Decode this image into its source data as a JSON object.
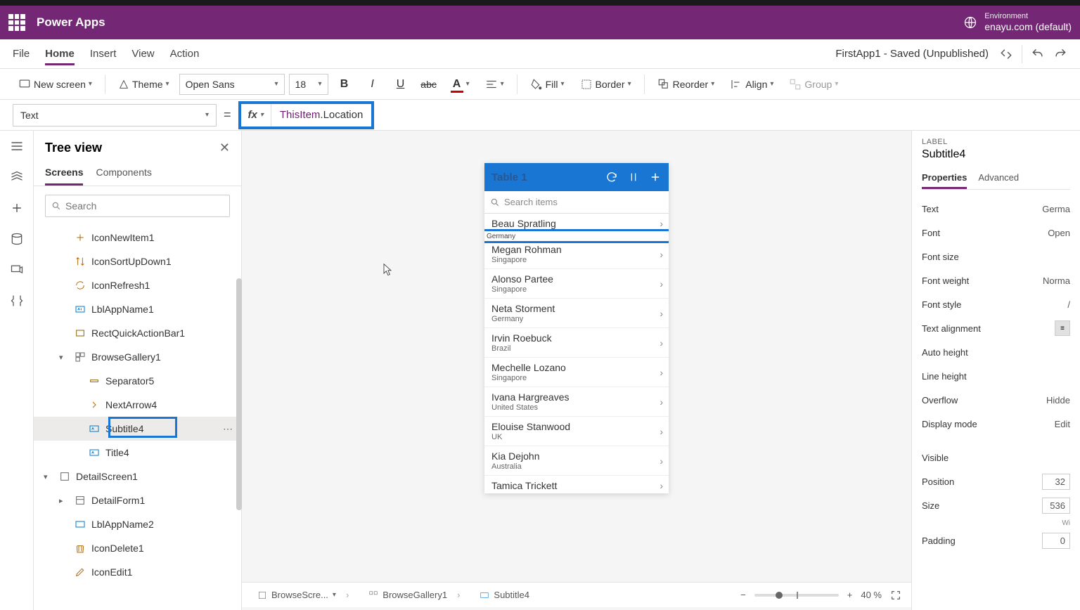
{
  "app": {
    "name": "Power Apps"
  },
  "env": {
    "label": "Environment",
    "value": "enayu.com (default)"
  },
  "menu": {
    "file": "File",
    "home": "Home",
    "insert": "Insert",
    "view": "View",
    "action": "Action",
    "doc": "FirstApp1 - Saved (Unpublished)"
  },
  "toolbar": {
    "newscreen": "New screen",
    "theme": "Theme",
    "font": "Open Sans",
    "size": "18",
    "fill": "Fill",
    "border": "Border",
    "reorder": "Reorder",
    "align": "Align",
    "group": "Group"
  },
  "formula": {
    "prop": "Text",
    "prefix": "ThisItem",
    "field": ".Location"
  },
  "tree": {
    "title": "Tree view",
    "tabs": {
      "screens": "Screens",
      "components": "Components"
    },
    "search": "Search",
    "items": {
      "iconNew": "IconNewItem1",
      "iconSort": "IconSortUpDown1",
      "iconRefresh": "IconRefresh1",
      "lblApp": "LblAppName1",
      "rect": "RectQuickActionBar1",
      "gallery": "BrowseGallery1",
      "sep": "Separator5",
      "arrow": "NextArrow4",
      "subtitle": "Subtitle4",
      "title": "Title4",
      "detail": "DetailScreen1",
      "form": "DetailForm1",
      "lblApp2": "LblAppName2",
      "iconDel": "IconDelete1",
      "iconEdit": "IconEdit1"
    }
  },
  "phone": {
    "header": "Table 1",
    "searchPlaceholder": "Search items",
    "selectedSub": "Germany",
    "rows": [
      {
        "name": "Beau Spratling",
        "sub": "Germany"
      },
      {
        "name": "Megan Rohman",
        "sub": "Singapore"
      },
      {
        "name": "Alonso Partee",
        "sub": "Singapore"
      },
      {
        "name": "Neta Storment",
        "sub": "Germany"
      },
      {
        "name": "Irvin Roebuck",
        "sub": "Brazil"
      },
      {
        "name": "Mechelle Lozano",
        "sub": "Singapore"
      },
      {
        "name": "Ivana Hargreaves",
        "sub": "United States"
      },
      {
        "name": "Elouise Stanwood",
        "sub": "UK"
      },
      {
        "name": "Kia Dejohn",
        "sub": "Australia"
      },
      {
        "name": "Tamica Trickett",
        "sub": ""
      }
    ]
  },
  "props": {
    "kind": "LABEL",
    "name": "Subtitle4",
    "tabs": {
      "p": "Properties",
      "a": "Advanced"
    },
    "rows": {
      "text": "Text",
      "textVal": "Germa",
      "font": "Font",
      "fontVal": "Open",
      "fontsize": "Font size",
      "fontweight": "Font weight",
      "fontweightVal": "Norma",
      "fontstyle": "Font style",
      "fontstyleVal": "/",
      "textalign": "Text alignment",
      "autoheight": "Auto height",
      "lineheight": "Line height",
      "overflow": "Overflow",
      "overflowVal": "Hidde",
      "displaymode": "Display mode",
      "displaymodeVal": "Edit",
      "visible": "Visible",
      "position": "Position",
      "positionVal": "32",
      "size": "Size",
      "sizeVal": "536",
      "sizeNote": "Wi",
      "padding": "Padding",
      "paddingVal": "0"
    }
  },
  "status": {
    "c1": "BrowseScre...",
    "c2": "BrowseGallery1",
    "c3": "Subtitle4",
    "zoom": "40 %"
  }
}
